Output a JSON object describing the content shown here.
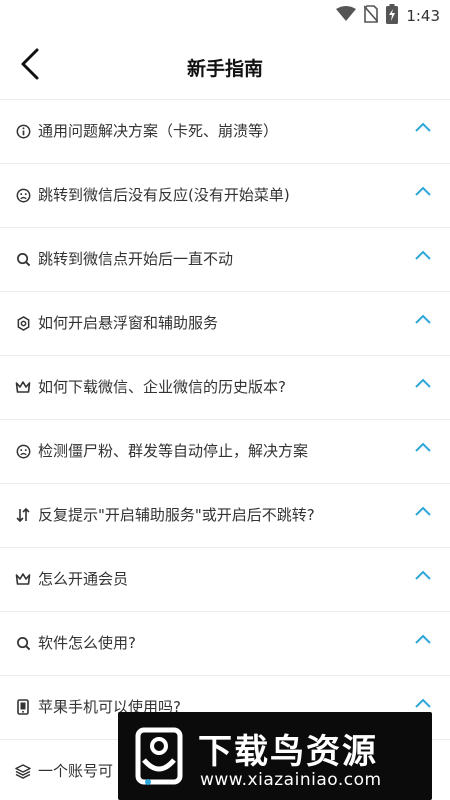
{
  "status_bar": {
    "time": "1:43",
    "icons": [
      "wifi-icon",
      "no-sim-icon",
      "battery-charging-icon"
    ]
  },
  "header": {
    "title": "新手指南",
    "back_icon": "back-arrow-icon"
  },
  "faq": [
    {
      "icon": "info-icon",
      "label": "通用问题解决方案（卡死、崩溃等）"
    },
    {
      "icon": "sad-face-icon",
      "label": "跳转到微信后没有反应(没有开始菜单)"
    },
    {
      "icon": "search-icon",
      "label": "跳转到微信点开始后一直不动"
    },
    {
      "icon": "gear-icon",
      "label": "如何开启悬浮窗和辅助服务"
    },
    {
      "icon": "crown-icon",
      "label": "如何下载微信、企业微信的历史版本?"
    },
    {
      "icon": "sad-face-icon",
      "label": "检测僵尸粉、群发等自动停止，解决方案"
    },
    {
      "icon": "swap-icon",
      "label": "反复提示\"开启辅助服务\"或开启后不跳转?"
    },
    {
      "icon": "crown-icon",
      "label": "怎么开通会员"
    },
    {
      "icon": "search-icon",
      "label": "软件怎么使用?"
    },
    {
      "icon": "phone-icon",
      "label": "苹果手机可以使用吗?"
    },
    {
      "icon": "layers-icon",
      "label": "一个账号可"
    }
  ],
  "watermark": {
    "name": "下载鸟资源",
    "url": "www.xiazainiao.com"
  },
  "colors": {
    "accent": "#2fa6d8",
    "divider": "#ececec",
    "text": "#333333"
  }
}
